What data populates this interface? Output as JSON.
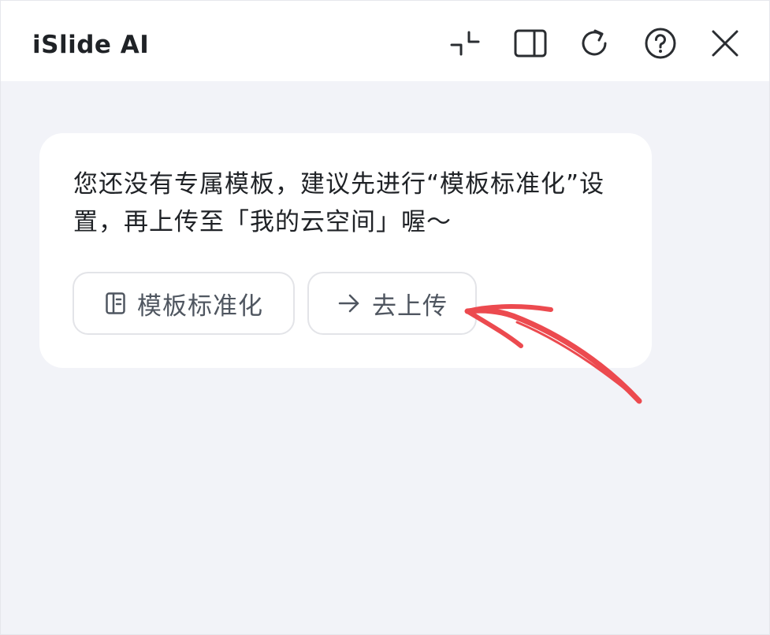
{
  "window": {
    "title": "iSlide AI",
    "controls": [
      "collapse-icon",
      "split-view-icon",
      "refresh-icon",
      "help-icon",
      "close-icon"
    ]
  },
  "message": {
    "text": "您还没有专属模板，建议先进行“模板标准化”设置，再上传至「我的云空间」喔～"
  },
  "actions": {
    "standardize": {
      "label": "模板标准化",
      "icon": "template-book-icon"
    },
    "upload": {
      "label": "去上传",
      "icon": "arrow-right-icon"
    }
  },
  "colors": {
    "background": "#f2f3f8",
    "card": "#ffffff",
    "text": "#1f2226",
    "button_text": "#4f5660",
    "annotation_arrow": "#ec4a4f"
  }
}
